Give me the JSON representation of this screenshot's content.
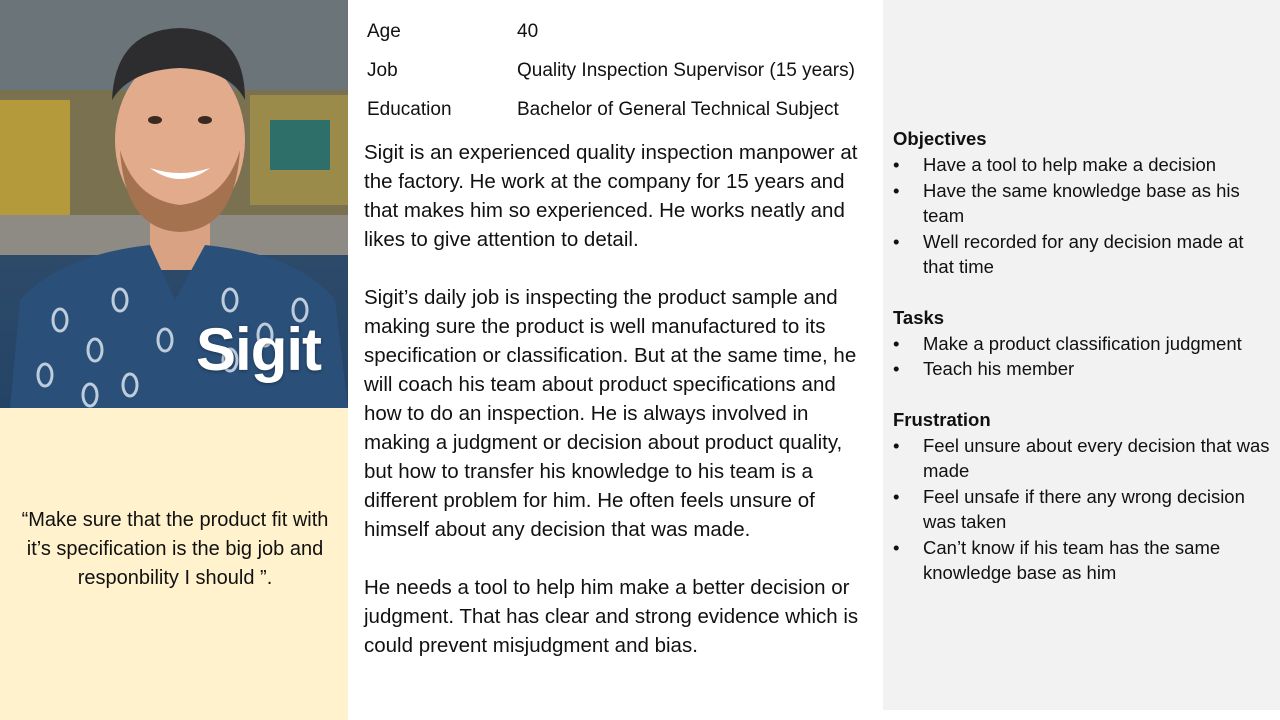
{
  "persona": {
    "name": "Sigit",
    "quote": "“Make sure that the product fit with it’s specification is the big job and responbility I should ”."
  },
  "profile": [
    {
      "label": "Age",
      "value": "40"
    },
    {
      "label": "Job",
      "value": "Quality Inspection Supervisor (15 years)"
    },
    {
      "label": "Education",
      "value": "Bachelor of General Technical Subject"
    }
  ],
  "bio": [
    "Sigit is an experienced quality inspection manpower at the factory. He work at the company for 15 years and that makes him so experienced. He works neatly and likes to give attention to detail.",
    "Sigit’s daily job is inspecting the product sample and making sure the product is well manufactured to its specification or classification. But at the same time, he will coach his team about product specifications and how to do an inspection. He is always involved in making a judgment or decision about product quality, but how to transfer his knowledge to his team is a different problem for him. He often feels unsure of himself about any decision that was made.",
    "He needs a tool to help him make a better decision or judgment. That has clear and strong evidence which is could prevent misjudgment and bias."
  ],
  "sections": [
    {
      "title": "Objectives",
      "items": [
        "Have a tool to help make a decision",
        "Have the same knowledge base as his team",
        "Well recorded for any decision made at that time"
      ]
    },
    {
      "title": "Tasks",
      "items": [
        "Make a product classification judgment",
        "Teach his member"
      ]
    },
    {
      "title": "Frustration",
      "items": [
        "Feel unsure about every decision that was made",
        "Feel unsafe if there any wrong decision was taken",
        "Can’t know if his team has the same knowledge base as him"
      ]
    }
  ],
  "bullet_glyph": "•",
  "colors": {
    "quote_background": "#fff2cc",
    "side_background": "#f2f2f2",
    "name_text": "#ffffff"
  }
}
